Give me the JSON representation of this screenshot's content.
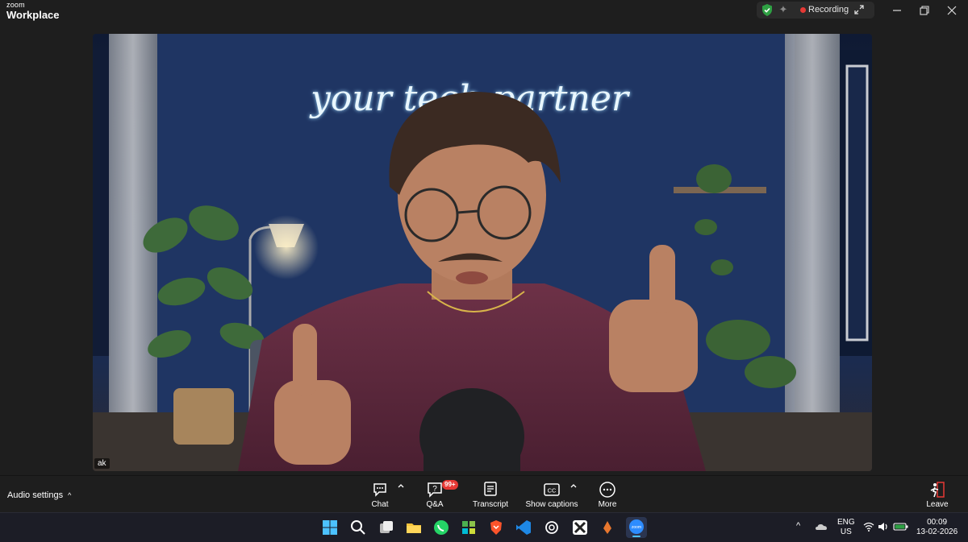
{
  "app": {
    "brand_small": "zoom",
    "brand_name": "Workplace",
    "recording_label": "Recording",
    "colors": {
      "recording_dot": "#e53935",
      "shield": "#2ea043",
      "badge": "#e53935"
    }
  },
  "video": {
    "participant_name": "ak",
    "neon_sign_text": "your tech partner"
  },
  "controls": {
    "audio_settings_label": "Audio settings",
    "chat_label": "Chat",
    "qa_label": "Q&A",
    "qa_badge": "99+",
    "transcript_label": "Transcript",
    "captions_label": "Show captions",
    "captions_icon_text": "CC",
    "more_label": "More",
    "leave_label": "Leave"
  },
  "taskbar": {
    "apps": [
      "windows-start-icon",
      "search-icon",
      "task-view-icon",
      "file-explorer-icon",
      "whatsapp-icon",
      "app-grid-icon",
      "brave-icon",
      "vscode-icon",
      "chatgpt-icon",
      "capcut-icon",
      "zoom-icon"
    ],
    "zoom_badge": "zoom",
    "lang_top": "ENG",
    "lang_bottom": "US",
    "time": "00:09",
    "date": "13-02-2026"
  }
}
